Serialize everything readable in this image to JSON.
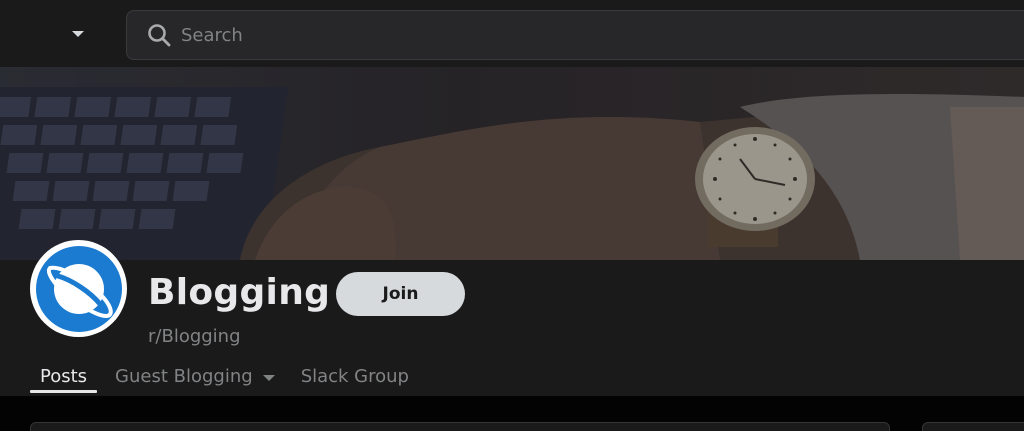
{
  "header": {
    "search_placeholder": "Search"
  },
  "community": {
    "name": "Blogging",
    "subreddit": "r/Blogging",
    "join_label": "Join"
  },
  "tabs": [
    {
      "label": "Posts",
      "active": true
    },
    {
      "label": "Guest Blogging",
      "active": false,
      "has_dropdown": true
    },
    {
      "label": "Slack Group",
      "active": false
    }
  ],
  "colors": {
    "background": "#1a1a1b",
    "avatar_blue": "#1a7bd0",
    "join_button": "#d7dadc",
    "muted_text": "#818384"
  }
}
